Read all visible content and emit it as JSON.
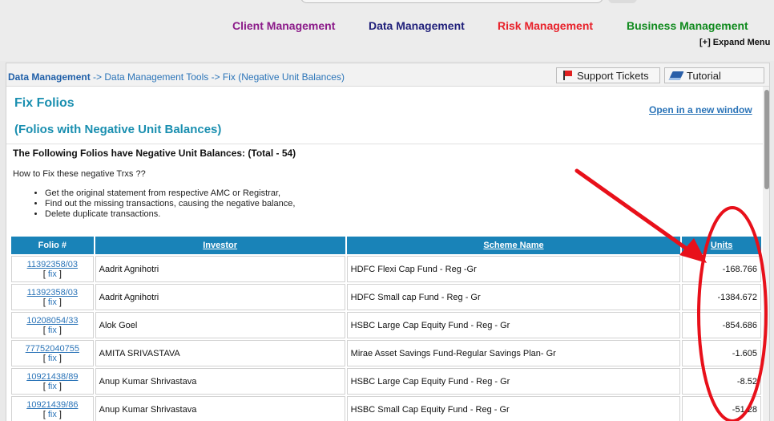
{
  "nav": {
    "client": "Client Management",
    "data": "Data Management",
    "risk": "Risk Management",
    "business": "Business Management",
    "expand": "[+] Expand Menu"
  },
  "breadcrumb": {
    "root": "Data Management",
    "rest": " -> Data Management Tools -> Fix (Negative Unit Balances)"
  },
  "toolbar": {
    "support": "Support Tickets",
    "tutorial": "Tutorial"
  },
  "page": {
    "title": "Fix Folios",
    "subtitle": "(Folios with Negative Unit Balances)",
    "open_new": "Open in a new window",
    "heading": "The Following Folios have Negative Unit Balances: (Total - 54)",
    "howto": "How to Fix these negative Trxs ??",
    "bullets": [
      "Get the original statement from respective AMC or Registrar,",
      "Find out the missing transactions, causing the negative balance,",
      "Delete duplicate transactions."
    ]
  },
  "table": {
    "headers": [
      "Folio #",
      "Investor",
      "Scheme Name",
      "Units"
    ],
    "fix_label": "fix",
    "rows": [
      {
        "folio": "11392358/03",
        "investor": "Aadrit Agnihotri",
        "scheme": "HDFC Flexi Cap Fund - Reg -Gr",
        "units": "-168.766"
      },
      {
        "folio": "11392358/03",
        "investor": "Aadrit Agnihotri",
        "scheme": "HDFC Small cap Fund - Reg - Gr",
        "units": "-1384.672"
      },
      {
        "folio": "10208054/33",
        "investor": "Alok Goel",
        "scheme": "HSBC Large Cap Equity Fund - Reg - Gr",
        "units": "-854.686"
      },
      {
        "folio": "77752040755",
        "investor": "AMITA SRIVASTAVA",
        "scheme": "Mirae Asset Savings Fund-Regular Savings Plan- Gr",
        "units": "-1.605"
      },
      {
        "folio": "10921438/89",
        "investor": "Anup Kumar Shrivastava",
        "scheme": "HSBC Large Cap Equity Fund - Reg - Gr",
        "units": "-8.52"
      },
      {
        "folio": "10921439/86",
        "investor": "Anup Kumar Shrivastava",
        "scheme": "HSBC Small Cap Equity Fund - Reg - Gr",
        "units": "-51.28"
      }
    ]
  },
  "colors": {
    "annotation": "#e8101a"
  }
}
